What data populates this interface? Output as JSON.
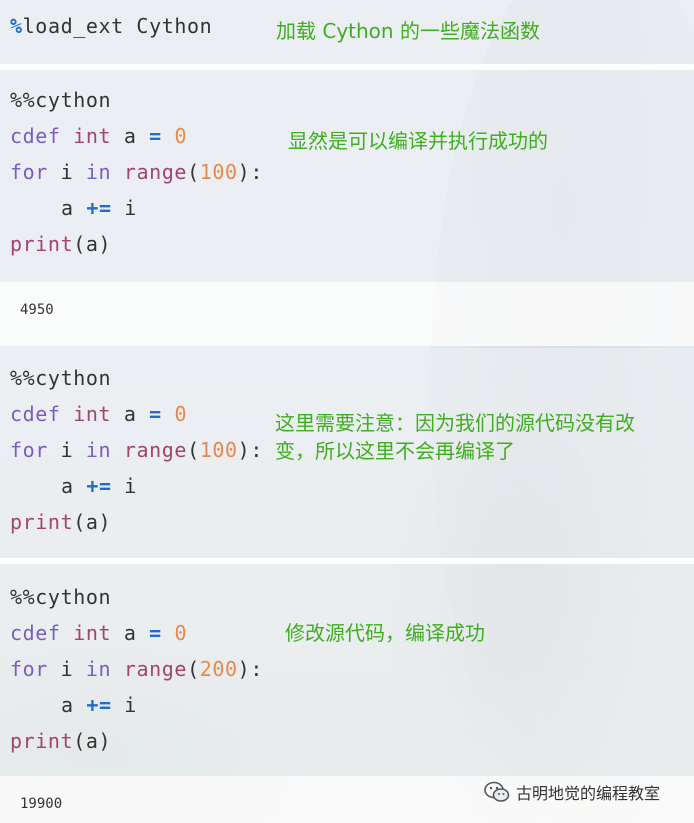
{
  "cells": {
    "cell1": {
      "magic": "%",
      "code": "load_ext Cython",
      "note": "加载 Cython 的一些魔法函数"
    },
    "cell2": {
      "header": "%%cython",
      "line1": {
        "kw": "cdef",
        "type": "int",
        "var": "a",
        "op": "=",
        "val": "0"
      },
      "line2": {
        "kw": "for",
        "var": "i",
        "in": "in",
        "fn": "range",
        "arg": "100",
        "tail": "):"
      },
      "line3": {
        "var": "a",
        "op": "+=",
        "rhs": "i"
      },
      "line4": {
        "fn": "print",
        "arg": "(a)"
      },
      "note": "显然是可以编译并执行成功的",
      "output": "4950"
    },
    "cell3": {
      "header": "%%cython",
      "line1": {
        "kw": "cdef",
        "type": "int",
        "var": "a",
        "op": "=",
        "val": "0"
      },
      "line2": {
        "kw": "for",
        "var": "i",
        "in": "in",
        "fn": "range",
        "arg": "100",
        "tail": "):"
      },
      "line3": {
        "var": "a",
        "op": "+=",
        "rhs": "i"
      },
      "line4": {
        "fn": "print",
        "arg": "(a)"
      },
      "note_line1": "这里需要注意：因为我们的源代码没有改",
      "note_line2": "变，所以这里不会再编译了"
    },
    "cell4": {
      "header": "%%cython",
      "line1": {
        "kw": "cdef",
        "type": "int",
        "var": "a",
        "op": "=",
        "val": "0"
      },
      "line2": {
        "kw": "for",
        "var": "i",
        "in": "in",
        "fn": "range",
        "arg": "200",
        "tail": "):"
      },
      "line3": {
        "var": "a",
        "op": "+=",
        "rhs": "i"
      },
      "line4": {
        "fn": "print",
        "arg": "(a)"
      },
      "note": "修改源代码，编译成功",
      "output": "19900"
    }
  },
  "watermark": {
    "icon": "wechat-icon",
    "text": "古明地觉的编程教室"
  },
  "colors": {
    "note_green": "#3fae1f",
    "keyword_purple": "#7b5cc0",
    "builtin_magenta": "#a3456a",
    "number_orange": "#e8884a",
    "operator_blue": "#1f6bd4"
  }
}
